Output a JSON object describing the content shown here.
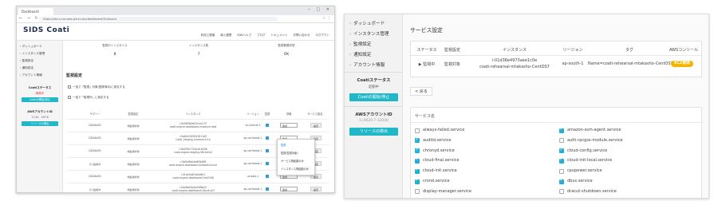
{
  "left_screen": {
    "tab_title": "Dashboard",
    "url": "https://dev-v-rsa.aws.pirnt.com/dashboard/?instance",
    "logo": "SIDS Coati",
    "top_nav": [
      "利用上限値",
      "導入連携",
      "SDKヘルプ",
      "ブログ",
      "ドキュメント",
      "お問い合わせ",
      "ログアウト"
    ],
    "sidebar": {
      "items": [
        "ダッシュボード",
        "インスタンス管理",
        "監視設定",
        "通知設定",
        "アカウント情報"
      ],
      "coati_status_title": "Coatiステータス",
      "coati_status_value": "稼働中",
      "coati_button": "Coatiの開始/停止",
      "aws_title": "AWSアカウントID",
      "aws_id": "1234...5678",
      "aws_button": "リソースの検出"
    },
    "summary": [
      {
        "label": "監視中インスタンス",
        "value": "8"
      },
      {
        "label": "インスタンス数",
        "value": "7"
      },
      {
        "label": "監視概要状態",
        "value": "OK"
      }
    ],
    "section_title": "監視設定",
    "checks": [
      "一括で「監視」対象(登録済み)に設定する",
      "一括で「監視外」に設定する"
    ],
    "table_headers": [
      "サマリー",
      "監視設定",
      "インスタンス",
      "リージョン",
      "監視",
      "詳細",
      "サービス設定"
    ],
    "rows": [
      {
        "summary": "DISABLED",
        "status": "非監視対象",
        "instance": "i-0e58f5b0e01a1e272\ncoati-engine-dashboard-instance-host",
        "region": "eu-central-1",
        "select": "監視",
        "button": "設定"
      },
      {
        "summary": "DISABLED",
        "status": "非監視対象",
        "instance": "i-0ab3c52f9041811d9\nCoati_Staging_Instance1c1a",
        "region": "ap-northeast-1",
        "select": "監視",
        "button": "設定"
      },
      {
        "summary": "DISABLED",
        "status": "非監視対象",
        "instance": "i-0b435e772a1b1b03b\ncoati-engine-staging-0fb1d2a3",
        "region": "ap-northeast-1",
        "select": "監視",
        "button": "設定"
      },
      {
        "summary": "(1) 監視外",
        "status": "非監視対象",
        "instance": "i-0bf5d5bb3e6f3b6f8\ncoati-engine-dashboard-AmazonLinux2",
        "region": "ap-northeast-1",
        "select": "監視",
        "button": "設定"
      },
      {
        "summary": "DISABLED",
        "status": "非監視対象",
        "instance": "i-01a03a4f1a0e8e1\ncoati-engine-dashboard-CentOS8",
        "region": "us-east-1",
        "select": "監視",
        "button": "設定"
      },
      {
        "summary": "(1) 監視外",
        "status": "非監視対象",
        "instance": "i-0dc6be3e4a42f8b02\ncoati-engine-dashboard-Ubuntu20",
        "region": "ap-northeast-1",
        "select": "監視",
        "button": "設定"
      }
    ],
    "dropdown": [
      "監視",
      "監視(監視対象)",
      "サービス再起動のみ",
      "インスタンス再起動のみ"
    ]
  },
  "right_screen": {
    "sidebar": {
      "items": [
        "ダッシュボード",
        "インスタンス管理",
        "監視設定",
        "通知設定",
        "アカウント情報"
      ],
      "coati_status_title": "Coatiステータス",
      "coati_status_value": "起動中",
      "coati_button": "Coatiの開始/停止",
      "aws_title": "AWSアカウントID",
      "aws_id": "1-(4620-7-120(8)",
      "aws_button": "リソースの検出"
    },
    "heading": "サービス設定",
    "table": {
      "headers": [
        "ステータス",
        "監視設定",
        "インスタンス",
        "リージョン",
        "タグ",
        "AWSコンソール"
      ],
      "status": "▶ 監視中",
      "setting": "監視対象",
      "instance_id": "i-01d36e4973aee1c0e",
      "instance_name": "coati-rehearsal-mtakasho-CentOS7",
      "region": "ap-south-1",
      "tag": "Name=coati-rehearsal-mtakasho-CentOS7",
      "console_button": "EC2管理"
    },
    "back_button": "< 戻る",
    "services_header": "サービス名",
    "services_left": [
      {
        "name": "always-failed.service",
        "checked": false
      },
      {
        "name": "auditd.service",
        "checked": true
      },
      {
        "name": "chronyd.service",
        "checked": true
      },
      {
        "name": "cloud-final.service",
        "checked": true
      },
      {
        "name": "cloud-init.service",
        "checked": true
      },
      {
        "name": "crond.service",
        "checked": true
      },
      {
        "name": "display-manager.service",
        "checked": false
      }
    ],
    "services_right": [
      {
        "name": "amazon-ssm-agent.service",
        "checked": true
      },
      {
        "name": "auth-rpcgss-module.service",
        "checked": false
      },
      {
        "name": "cloud-config.service",
        "checked": true
      },
      {
        "name": "cloud-init-local.service",
        "checked": true
      },
      {
        "name": "cpupower.service",
        "checked": false
      },
      {
        "name": "dbus.service",
        "checked": true
      },
      {
        "name": "dracut-shutdown.service",
        "checked": false
      }
    ]
  }
}
